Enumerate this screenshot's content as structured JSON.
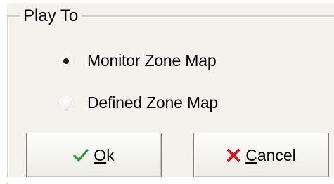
{
  "group": {
    "title": "Play To"
  },
  "options": [
    {
      "label": "Monitor Zone Map",
      "selected": true
    },
    {
      "label": "Defined Zone Map",
      "selected": false
    }
  ],
  "buttons": {
    "ok": {
      "accel": "O",
      "rest": "k",
      "icon": "checkmark-icon",
      "icon_color": "#2e9a2e"
    },
    "cancel": {
      "accel": "C",
      "rest": "ancel",
      "icon": "x-icon",
      "icon_color": "#cc1a1a"
    }
  }
}
